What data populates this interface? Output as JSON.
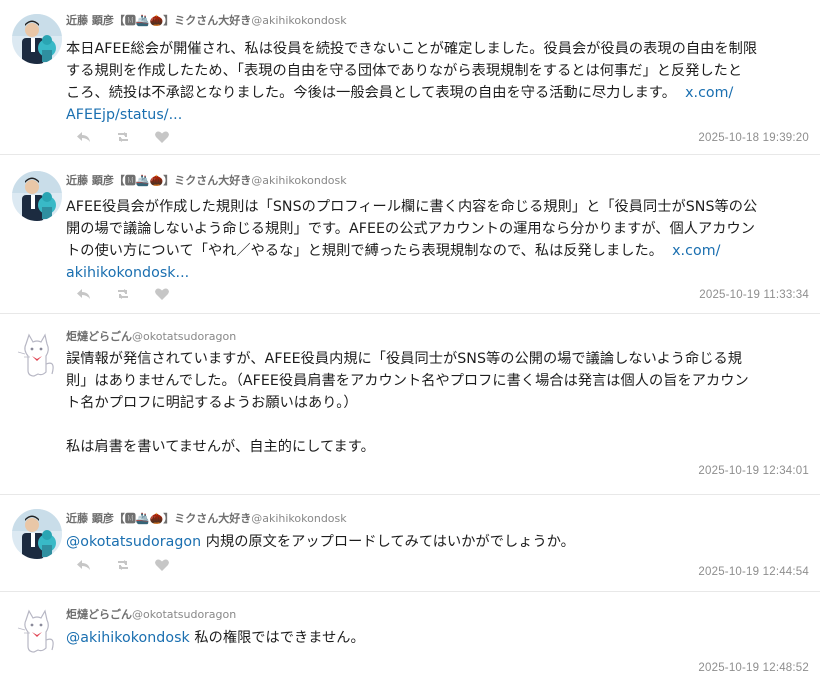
{
  "timeline": {
    "tweets": [
      {
        "avatar": "person-avatar",
        "display_name": "近藤 顕彦【🅼🚢🌰】ミクさん大好き",
        "handle": "@akihikokondosk",
        "lines": [
          "本日AFEE総会が開催され、私は役員を続投できないことが確定しました。役員会が役員の表現の自由を制限",
          "する規則を作成したため、「表現の自由を守る団体でありながら表現規制をするとは何事だ」と反発したと",
          "ころ、続投は不承認となりました。今後は一般会員として表現の自由を守る活動に尽力します。"
        ],
        "link_a": "x.com/",
        "link_b": "AFEEjp/status/...",
        "timestamp": "2025-10-18 19:39:20"
      },
      {
        "avatar": "person-avatar",
        "display_name": "近藤 顕彦【🅼🚢🌰】ミクさん大好き",
        "handle": "@akihikokondosk",
        "lines": [
          "AFEE役員会が作成した規則は「SNSのプロフィール欄に書く内容を命じる規則」と「役員同士がSNS等の公",
          "開の場で議論しないよう命じる規則」です。AFEEの公式アカウントの運用なら分かりますが、個人アカウン",
          "トの使い方について「やれ／やるな」と規則で縛ったら表現規制なので、私は反発しました。"
        ],
        "link_a": "x.com/",
        "link_b": "akihikokondosk...",
        "timestamp": "2025-10-19 11:33:34"
      },
      {
        "avatar": "cat-avatar",
        "display_name": "炬燵どらごん",
        "handle": "@okotatsudoragon",
        "lines": [
          "誤情報が発信されていますが、AFEE役員内規に「役員同士がSNS等の公開の場で議論しないよう命じる規",
          "則」はありませんでした。（AFEE役員肩書をアカウント名やプロフに書く場合は発言は個人の旨をアカウン",
          "ト名かプロフに明記するようお願いはあり。）",
          "",
          "私は肩書を書いてませんが、自主的にしてます。"
        ],
        "timestamp": "2025-10-19 12:34:01"
      },
      {
        "avatar": "person-avatar",
        "display_name": "近藤 顕彦【🅼🚢🌰】ミクさん大好き",
        "handle": "@akihikokondosk",
        "mention": "@okotatsudoragon",
        "text": " 内規の原文をアップロードしてみてはいかがでしょうか。",
        "timestamp": "2025-10-19 12:44:54"
      },
      {
        "avatar": "cat-avatar",
        "display_name": "炬燵どらごん",
        "handle": "@okotatsudoragon",
        "mention": "@akihikokondosk",
        "text": " 私の権限ではできません。",
        "timestamp": "2025-10-19 12:48:52"
      }
    ]
  },
  "icons": [
    "reply-icon",
    "retweet-icon",
    "like-icon"
  ],
  "colors": {
    "link": "#1a6fb0",
    "meta": "#8e8e8e",
    "divider": "#e8e8e8"
  }
}
